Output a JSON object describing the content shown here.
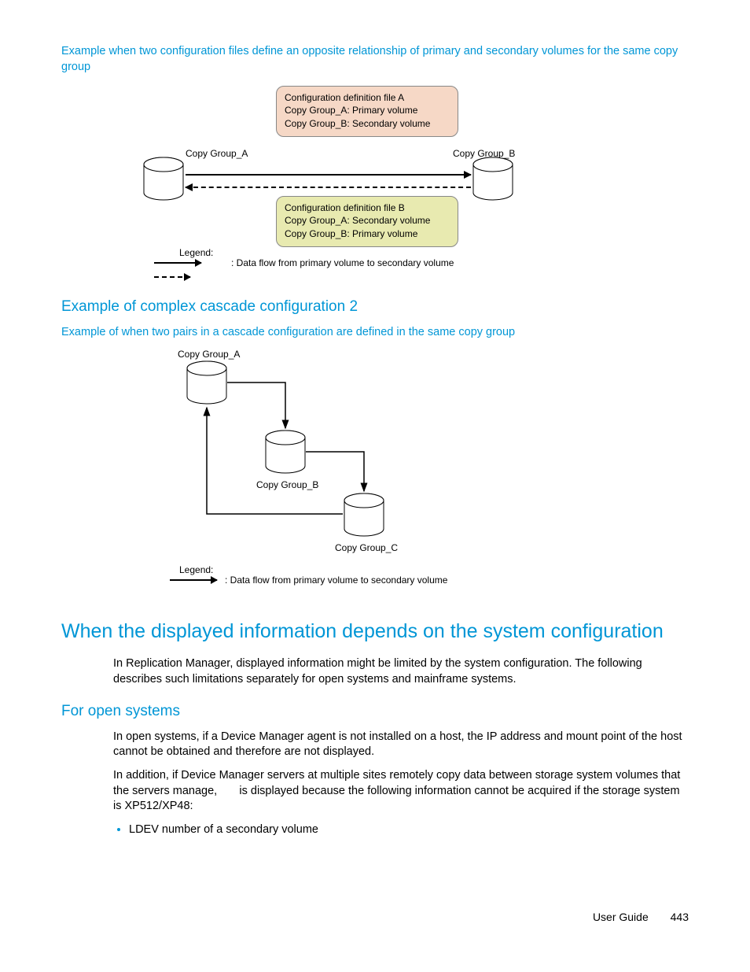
{
  "intro_caption": "Example when two configuration files define an opposite relationship of primary and secondary volumes for the same copy group",
  "fig1": {
    "groupA": "Copy Group_A",
    "groupB": "Copy Group_B",
    "boxA": {
      "title": "Configuration definition file A",
      "l1": "Copy Group_A: Primary volume",
      "l2": "Copy Group_B: Secondary volume"
    },
    "boxB": {
      "title": "Configuration definition file B",
      "l1": "Copy Group_A: Secondary volume",
      "l2": "Copy Group_B: Primary volume"
    },
    "legend_label": "Legend:",
    "legend_text": ": Data flow from primary volume to secondary volume"
  },
  "h3_cascade": "Example of complex cascade configuration 2",
  "cascade_caption": "Example of when two pairs in a cascade configuration are defined in the same copy group",
  "fig2": {
    "groupA": "Copy Group_A",
    "groupB": "Copy Group_B",
    "groupC": "Copy Group_C",
    "legend_label": "Legend:",
    "legend_text": ": Data flow from primary volume to secondary volume"
  },
  "h2_system": "When the displayed information depends on the system configuration",
  "system_para": "In Replication Manager, displayed information might be limited by the system configuration. The following describes such limitations separately for open systems and mainframe systems.",
  "h3_open": "For open systems",
  "open_p1": "In open systems, if a Device Manager agent is not installed on a host, the IP address and mount point of the host cannot be obtained and therefore are not displayed.",
  "open_p2": "In addition, if Device Manager servers at multiple sites remotely copy data between storage system volumes that the servers manage,       is displayed because the following information cannot be acquired if the storage system is XP512/XP48:",
  "open_bullet1": "LDEV number of a secondary volume",
  "footer_label": "User Guide",
  "footer_page": "443"
}
